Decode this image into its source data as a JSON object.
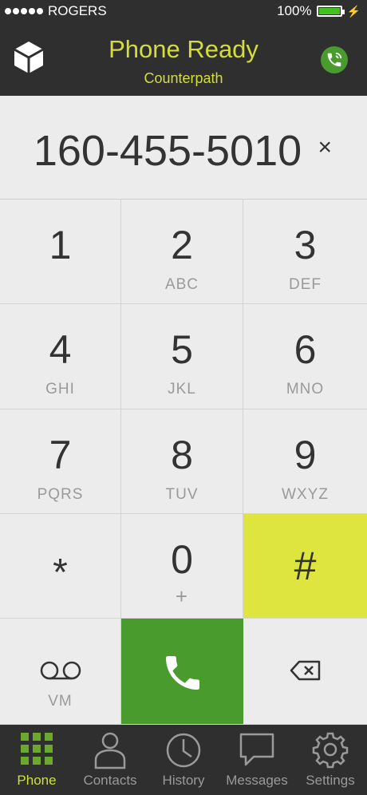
{
  "status_bar": {
    "carrier": "ROGERS",
    "battery_text": "100%",
    "battery_level": 1.0
  },
  "header": {
    "title": "Phone Ready",
    "subtitle": "Counterpath",
    "accent_color": "#d4dd3a",
    "status_icon": "phone-ready-icon"
  },
  "display": {
    "number": "160-455-5010",
    "clear_symbol": "×"
  },
  "keypad": {
    "keys": [
      {
        "digit": "1",
        "letters": ""
      },
      {
        "digit": "2",
        "letters": "ABC"
      },
      {
        "digit": "3",
        "letters": "DEF"
      },
      {
        "digit": "4",
        "letters": "GHI"
      },
      {
        "digit": "5",
        "letters": "JKL"
      },
      {
        "digit": "6",
        "letters": "MNO"
      },
      {
        "digit": "7",
        "letters": "PQRS"
      },
      {
        "digit": "8",
        "letters": "TUV"
      },
      {
        "digit": "9",
        "letters": "WXYZ"
      },
      {
        "digit": "*",
        "letters": ""
      },
      {
        "digit": "0",
        "letters": "+"
      },
      {
        "digit": "#",
        "letters": ""
      }
    ],
    "voicemail_label": "VM",
    "hash_color": "#dfe53f",
    "call_color": "#4a9b2e"
  },
  "tabs": [
    {
      "label": "Phone",
      "icon": "keypad-grid-icon",
      "active": true
    },
    {
      "label": "Contacts",
      "icon": "person-icon",
      "active": false
    },
    {
      "label": "History",
      "icon": "clock-icon",
      "active": false
    },
    {
      "label": "Messages",
      "icon": "speech-bubble-icon",
      "active": false
    },
    {
      "label": "Settings",
      "icon": "gear-icon",
      "active": false
    }
  ]
}
